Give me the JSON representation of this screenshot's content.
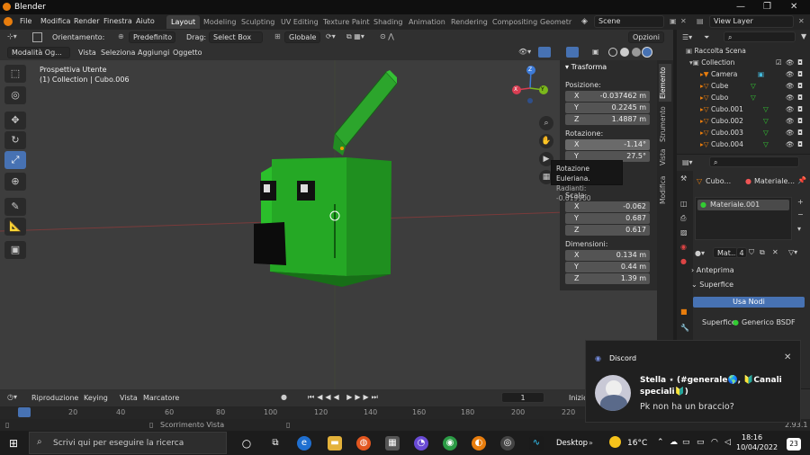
{
  "window": {
    "title": "Blender",
    "controls": [
      "—",
      "❐",
      "✕"
    ]
  },
  "menu": {
    "items": [
      "File",
      "Modifica",
      "Render",
      "Finestra",
      "Aiuto"
    ]
  },
  "workspaces": [
    "Layout",
    "Modeling",
    "Sculpting",
    "UV Editing",
    "Texture Paint",
    "Shading",
    "Animation",
    "Rendering",
    "Compositing",
    "Geometr"
  ],
  "scene": {
    "label": "Scene",
    "view_layer": "View Layer"
  },
  "tool_header": {
    "orientation_label": "Orientamento:",
    "orientation_value": "Predefinito",
    "drag_label": "Drag:",
    "drag_value": "Select Box",
    "transform_value": "Globale",
    "options_label": "Opzioni"
  },
  "viewport_header": {
    "mode": "Modalità Og...",
    "items": [
      "Vista",
      "Seleziona",
      "Aggiungi",
      "Oggetto"
    ]
  },
  "viewport": {
    "view_name": "Prospettiva Utente",
    "collection_info": "(1) Collection | Cubo.006"
  },
  "gizmo": {
    "z": "Z",
    "x": "X",
    "y": "Y"
  },
  "npanel": {
    "title": "Trasforma",
    "position_label": "Posizione:",
    "position": [
      {
        "axis": "X",
        "value": "-0.037462 m"
      },
      {
        "axis": "Y",
        "value": "0.2245 m"
      },
      {
        "axis": "Z",
        "value": "1.4887 m"
      }
    ],
    "rotation_label": "Rotazione:",
    "rotation": [
      {
        "axis": "X",
        "value": "-1.14°"
      },
      {
        "axis": "Y",
        "value": "27.5°"
      }
    ],
    "scale_label": "Scala:",
    "scale": [
      {
        "axis": "X",
        "value": "-0.062"
      },
      {
        "axis": "Y",
        "value": "0.687"
      },
      {
        "axis": "Z",
        "value": "0.617"
      }
    ],
    "dimensions_label": "Dimensioni:",
    "dimensions": [
      {
        "axis": "X",
        "value": "0.134 m"
      },
      {
        "axis": "Y",
        "value": "0.44 m"
      },
      {
        "axis": "Z",
        "value": "1.39 m"
      }
    ],
    "tabs": [
      "Elemento",
      "Strumento",
      "Vista",
      "Modifica"
    ]
  },
  "tooltip": {
    "title": "Rotazione Euleriana.",
    "detail": "Radianti: -0.019900"
  },
  "outliner": {
    "title": "Raccolta Scena",
    "rows": [
      "Collection",
      "Camera",
      "Cube",
      "Cubo",
      "Cubo.001",
      "Cubo.002",
      "Cubo.003",
      "Cubo.004"
    ]
  },
  "properties": {
    "object": "Cubo...",
    "material": "Materiale...",
    "slot": "Materiale.001",
    "mat_short": "Mat...",
    "users": "4",
    "preview": "Anteprima",
    "surface_section": "Superfice",
    "use_nodes": "Usa Nodi",
    "surface_label": "Superfice",
    "surface_value": "Generico BSDF"
  },
  "timeline": {
    "items": [
      "Riproduzione",
      "Keying",
      "Vista",
      "Marcatore"
    ],
    "frame": "1",
    "start_label": "Inizio",
    "ticks": [
      "20",
      "40",
      "60",
      "80",
      "100",
      "120",
      "140",
      "160",
      "180",
      "200",
      "220"
    ]
  },
  "status": {
    "text": "Scorrimento Vista",
    "version": "2.93.1"
  },
  "discord": {
    "app": "Discord",
    "sender": "Stella ⋆ (#generale🌎, 🔰Canali speciali🔰)",
    "message": "Pk non ha un braccio?"
  },
  "taskbar": {
    "search_placeholder": "Scrivi qui per eseguire la ricerca",
    "desktop": "Desktop",
    "temp": "16°C",
    "time": "18:16",
    "date": "10/04/2022",
    "notif": "23"
  }
}
